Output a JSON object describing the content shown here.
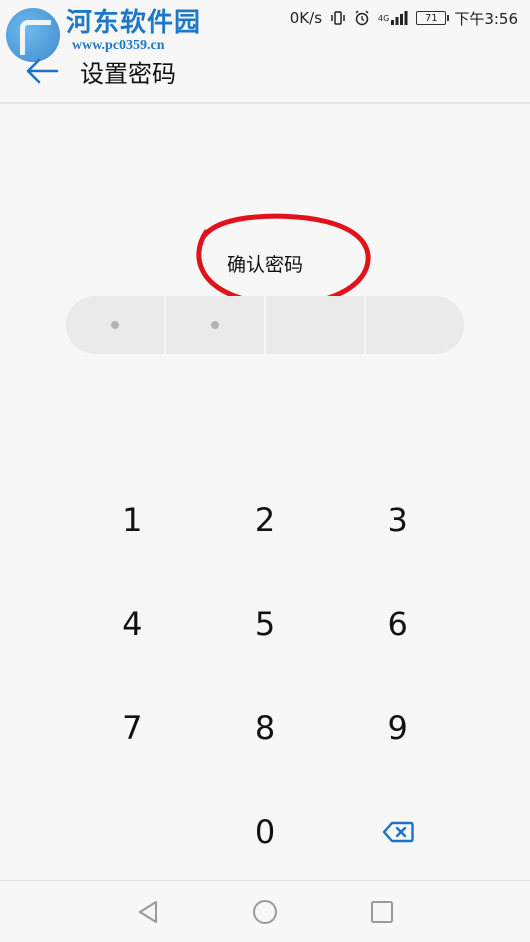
{
  "status_bar": {
    "speed": "0K/s",
    "network": "4G",
    "battery": "71",
    "time": "下午3:56"
  },
  "watermark": {
    "title": "河东软件园",
    "url": "www.pc0359.cn"
  },
  "header": {
    "title": "设置密码",
    "back_icon": "arrow-left-icon"
  },
  "prompt": {
    "text": "确认密码"
  },
  "pin": {
    "length": 4,
    "filled": 2
  },
  "keypad": {
    "keys": [
      "1",
      "2",
      "3",
      "4",
      "5",
      "6",
      "7",
      "8",
      "9",
      "",
      "0",
      "backspace"
    ],
    "backspace_icon": "backspace-icon"
  },
  "colors": {
    "accent": "#1a73c8",
    "annotation": "#e0131d",
    "background": "#f7f7f7"
  },
  "nav_bar": {
    "icons": [
      "back-triangle-icon",
      "home-circle-icon",
      "recents-square-icon"
    ]
  }
}
